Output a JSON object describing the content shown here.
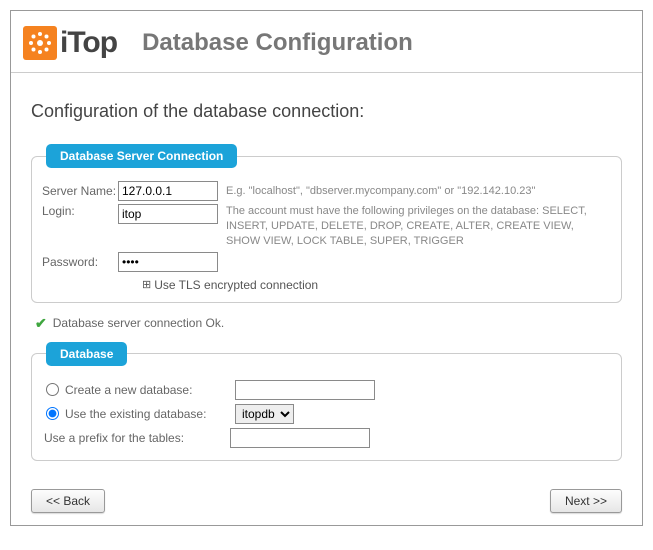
{
  "logo": {
    "text": "iTop"
  },
  "header": {
    "title": "Database Configuration"
  },
  "subheading": "Configuration of the database connection:",
  "conn": {
    "legend": "Database Server Connection",
    "server": {
      "label": "Server Name:",
      "value": "127.0.0.1",
      "hint": "E.g. \"localhost\", \"dbserver.mycompany.com\" or \"192.142.10.23\""
    },
    "login": {
      "label": "Login:",
      "value": "itop",
      "hint": "The account must have the following privileges on the database: SELECT, INSERT, UPDATE, DELETE, DROP, CREATE, ALTER, CREATE VIEW, SHOW VIEW, LOCK TABLE, SUPER, TRIGGER"
    },
    "password": {
      "label": "Password:",
      "value": "••••"
    },
    "tls_label": "Use TLS encrypted connection"
  },
  "status": {
    "ok_text": "Database server connection Ok."
  },
  "db": {
    "legend": "Database",
    "create_label": "Create a new database:",
    "create_value": "",
    "use_label": "Use the existing database:",
    "selected": "itopdb",
    "options": [
      "itopdb"
    ],
    "prefix_label": "Use a prefix for the tables:",
    "prefix_value": ""
  },
  "nav": {
    "back": "<< Back",
    "next": "Next >>"
  }
}
